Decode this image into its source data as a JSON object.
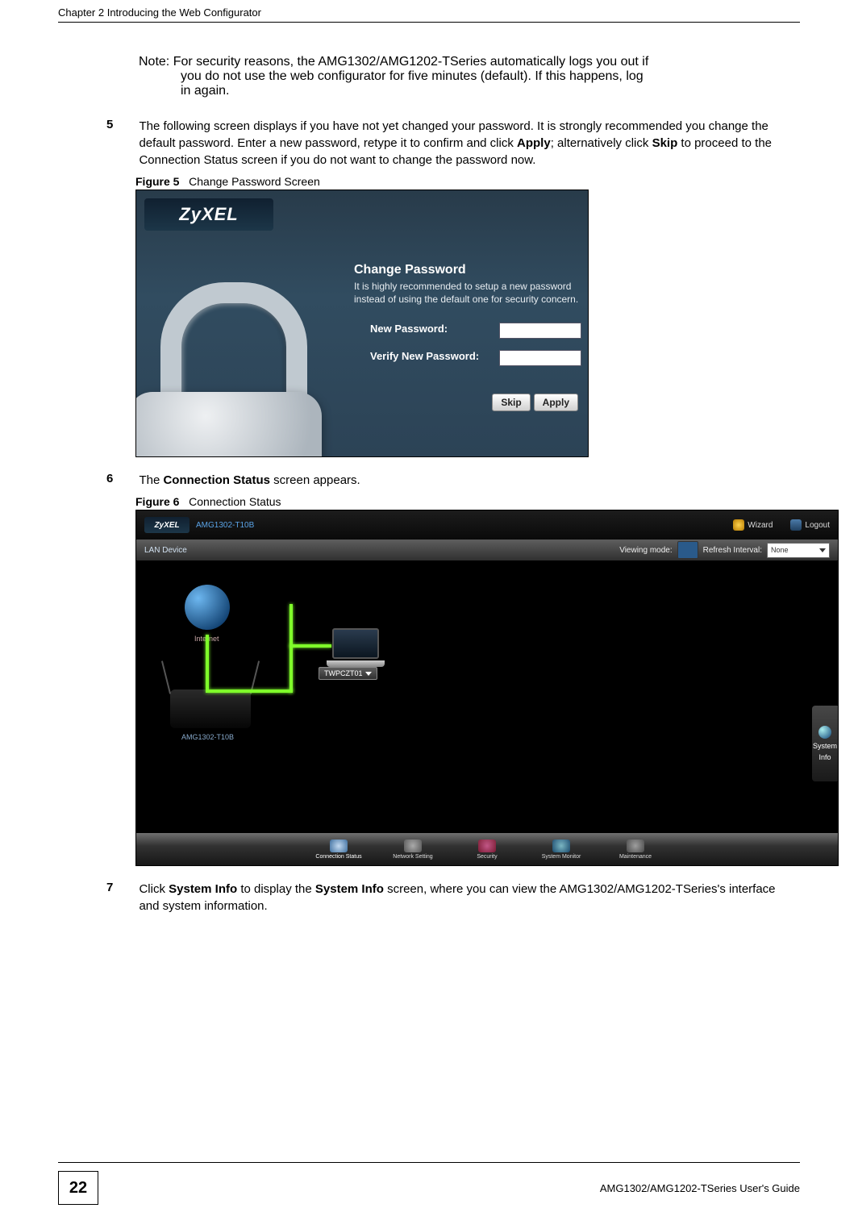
{
  "header": {
    "chapter": "Chapter 2 Introducing the Web Configurator"
  },
  "note": {
    "prefix": "Note:",
    "line1": "For security reasons, the AMG1302/AMG1202-TSeries automatically logs you out if",
    "line2": "you do not use the web configurator for five minutes (default). If this happens, log",
    "line3": "in again."
  },
  "step5": {
    "num": "5",
    "t1": "The following screen displays if you have not yet changed your password. It is strongly recommended you change the default password. Enter a new password, retype it to confirm and click ",
    "apply": "Apply",
    "t2": "; alternatively click ",
    "skip": "Skip",
    "t3": " to proceed to the Connection Status screen if you do not want to change the password now."
  },
  "figure5": {
    "cap_prefix": "Figure 5",
    "cap_text": "Change Password Screen",
    "brand": "ZyXEL",
    "heading": "Change Password",
    "sub": "It is highly recommended to setup a new password instead of using the default one for security concern.",
    "new_pw_label": "New Password:",
    "verify_pw_label": "Verify New Password:",
    "btn_skip": "Skip",
    "btn_apply": "Apply"
  },
  "step6": {
    "num": "6",
    "t1": "The ",
    "conn_status": "Connection Status",
    "t2": " screen appears."
  },
  "figure6": {
    "cap_prefix": "Figure 6",
    "cap_text": "Connection Status",
    "brand": "ZyXEL",
    "model": "AMG1302-T10B",
    "wizard": "Wizard",
    "logout": "Logout",
    "lan_device": "LAN Device",
    "viewing_mode": "Viewing mode:",
    "refresh_interval": "Refresh Interval:",
    "refresh_value": "None",
    "internet_label": "Internet",
    "router_label": "AMG1302-T10B",
    "laptop_tag": "TWPCZT01",
    "system_info_side1": "System",
    "system_info_side2": "Info",
    "nav": {
      "conn": "Connection Status",
      "net": "Network Setting",
      "sec": "Security",
      "mon": "System Monitor",
      "mnt": "Maintenance"
    }
  },
  "step7": {
    "num": "7",
    "t1": "Click ",
    "sysinfo1": "System Info",
    "t2": " to display the ",
    "sysinfo2": "System Info",
    "t3": " screen, where you can view the AMG1302/AMG1202-TSeries's interface and system information."
  },
  "footer": {
    "page_number": "22",
    "guide": "AMG1302/AMG1202-TSeries User's Guide"
  }
}
